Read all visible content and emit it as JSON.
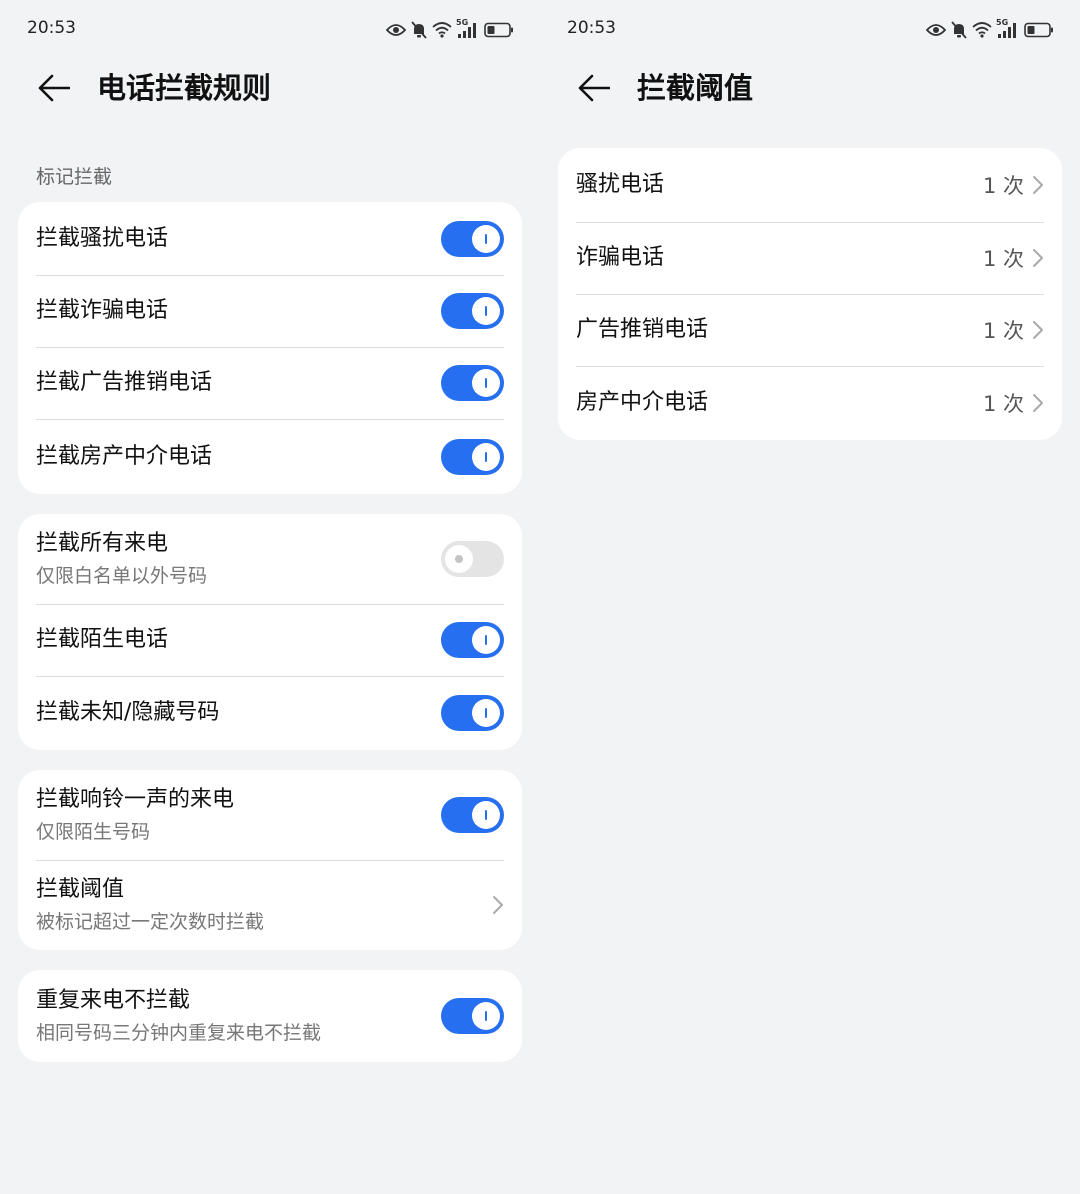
{
  "status": {
    "time": "20:53",
    "network": "5G"
  },
  "left": {
    "title": "电话拦截规则",
    "section_label": "标记拦截",
    "groups": [
      {
        "rows": [
          {
            "title": "拦截骚扰电话",
            "toggle": "on"
          },
          {
            "title": "拦截诈骗电话",
            "toggle": "on"
          },
          {
            "title": "拦截广告推销电话",
            "toggle": "on"
          },
          {
            "title": "拦截房产中介电话",
            "toggle": "on"
          }
        ]
      },
      {
        "rows": [
          {
            "title": "拦截所有来电",
            "subtitle": "仅限白名单以外号码",
            "toggle": "off"
          },
          {
            "title": "拦截陌生电话",
            "toggle": "on"
          },
          {
            "title": "拦截未知/隐藏号码",
            "toggle": "on"
          }
        ]
      },
      {
        "rows": [
          {
            "title": "拦截响铃一声的来电",
            "subtitle": "仅限陌生号码",
            "toggle": "on"
          },
          {
            "title": "拦截阈值",
            "subtitle": "被标记超过一定次数时拦截"
          }
        ]
      },
      {
        "rows": [
          {
            "title": "重复来电不拦截",
            "subtitle": "相同号码三分钟内重复来电不拦截",
            "toggle": "on"
          }
        ]
      }
    ]
  },
  "right": {
    "title": "拦截阈值",
    "rows": [
      {
        "title": "骚扰电话",
        "value": "1 次"
      },
      {
        "title": "诈骗电话",
        "value": "1 次"
      },
      {
        "title": "广告推销电话",
        "value": "1 次"
      },
      {
        "title": "房产中介电话",
        "value": "1 次"
      }
    ]
  },
  "colors": {
    "accent": "#266ff0",
    "background": "#f1f3f5",
    "card": "#ffffff"
  }
}
